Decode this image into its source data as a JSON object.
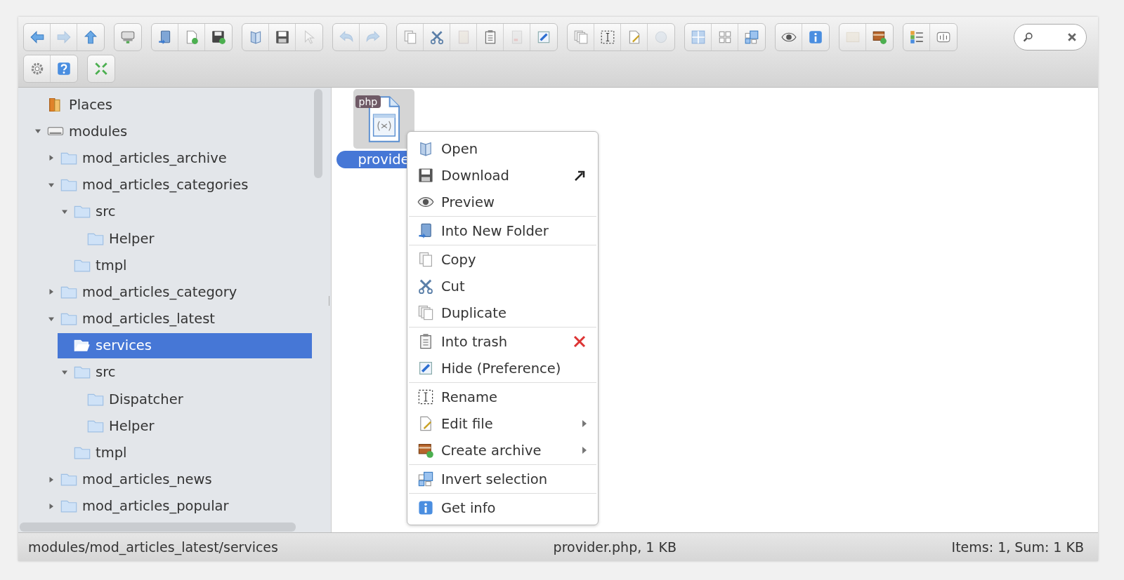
{
  "toolbar": {
    "rows": [
      [
        [
          {
            "kind": "back",
            "disabled": false
          },
          {
            "kind": "forward",
            "disabled": true
          },
          {
            "kind": "up",
            "disabled": false
          }
        ],
        [
          {
            "kind": "drive",
            "disabled": false
          }
        ],
        [
          {
            "kind": "newfolder",
            "disabled": false
          },
          {
            "kind": "newfile",
            "disabled": false
          },
          {
            "kind": "upload",
            "disabled": false
          }
        ],
        [
          {
            "kind": "open",
            "disabled": false
          },
          {
            "kind": "save",
            "disabled": false
          },
          {
            "kind": "select",
            "disabled": true
          }
        ],
        [
          {
            "kind": "undo",
            "disabled": true
          },
          {
            "kind": "redo",
            "disabled": true
          }
        ],
        [
          {
            "kind": "copy",
            "disabled": false
          },
          {
            "kind": "cut",
            "disabled": false
          },
          {
            "kind": "paste",
            "disabled": true
          },
          {
            "kind": "trash",
            "disabled": false
          },
          {
            "kind": "empty",
            "disabled": true
          },
          {
            "kind": "hide",
            "disabled": false
          }
        ],
        [
          {
            "kind": "duplicate",
            "disabled": false
          },
          {
            "kind": "rename",
            "disabled": false
          },
          {
            "kind": "edit",
            "disabled": false
          },
          {
            "kind": "resize",
            "disabled": true
          }
        ],
        [
          {
            "kind": "grid",
            "disabled": false
          },
          {
            "kind": "gridnone",
            "disabled": false
          },
          {
            "kind": "invert",
            "disabled": false
          }
        ],
        [
          {
            "kind": "eye",
            "disabled": false
          },
          {
            "kind": "info",
            "disabled": false
          }
        ],
        [
          {
            "kind": "extract",
            "disabled": true
          },
          {
            "kind": "archive",
            "disabled": false
          }
        ],
        [
          {
            "kind": "list",
            "disabled": false
          },
          {
            "kind": "sort",
            "disabled": false
          }
        ]
      ],
      [
        [
          {
            "kind": "gear",
            "disabled": false
          },
          {
            "kind": "help",
            "disabled": false
          }
        ],
        [
          {
            "kind": "fullscreen",
            "disabled": false
          }
        ]
      ]
    ]
  },
  "tree": [
    {
      "label": "Places",
      "kind": "places",
      "expandable": false,
      "expanded": false,
      "selected": false
    },
    {
      "label": "modules",
      "kind": "drive",
      "expandable": true,
      "expanded": true,
      "selected": false,
      "children": [
        {
          "label": "mod_articles_archive",
          "kind": "folder",
          "expandable": true,
          "expanded": false,
          "selected": false
        },
        {
          "label": "mod_articles_categories",
          "kind": "folder",
          "expandable": true,
          "expanded": true,
          "selected": false,
          "children": [
            {
              "label": "src",
              "kind": "folder",
              "expandable": true,
              "expanded": true,
              "selected": false,
              "children": [
                {
                  "label": "Helper",
                  "kind": "folder",
                  "expandable": false,
                  "expanded": false,
                  "selected": false
                }
              ]
            },
            {
              "label": "tmpl",
              "kind": "folder",
              "expandable": false,
              "expanded": false,
              "selected": false
            }
          ]
        },
        {
          "label": "mod_articles_category",
          "kind": "folder",
          "expandable": true,
          "expanded": false,
          "selected": false
        },
        {
          "label": "mod_articles_latest",
          "kind": "folder",
          "expandable": true,
          "expanded": true,
          "selected": false,
          "children": [
            {
              "label": "services",
              "kind": "folder",
              "expandable": false,
              "expanded": false,
              "selected": true
            },
            {
              "label": "src",
              "kind": "folder",
              "expandable": true,
              "expanded": true,
              "selected": false,
              "children": [
                {
                  "label": "Dispatcher",
                  "kind": "folder",
                  "expandable": false,
                  "expanded": false,
                  "selected": false
                },
                {
                  "label": "Helper",
                  "kind": "folder",
                  "expandable": false,
                  "expanded": false,
                  "selected": false
                }
              ]
            },
            {
              "label": "tmpl",
              "kind": "folder",
              "expandable": false,
              "expanded": false,
              "selected": false
            }
          ]
        },
        {
          "label": "mod_articles_news",
          "kind": "folder",
          "expandable": true,
          "expanded": false,
          "selected": false
        },
        {
          "label": "mod_articles_popular",
          "kind": "folder",
          "expandable": true,
          "expanded": false,
          "selected": false
        }
      ]
    }
  ],
  "files": [
    {
      "name": "provide",
      "badge": "php",
      "selected": true
    }
  ],
  "context_menu": {
    "groups": [
      [
        {
          "label": "Open",
          "kind": "open",
          "submenu": false
        },
        {
          "label": "Download",
          "kind": "download",
          "submenu": false
        },
        {
          "label": "Preview",
          "kind": "preview",
          "submenu": false
        }
      ],
      [
        {
          "label": "Into New Folder",
          "kind": "newfolder",
          "submenu": false
        }
      ],
      [
        {
          "label": "Copy",
          "kind": "copy",
          "submenu": false
        },
        {
          "label": "Cut",
          "kind": "cut",
          "submenu": false
        },
        {
          "label": "Duplicate",
          "kind": "duplicate",
          "submenu": false
        }
      ],
      [
        {
          "label": "Into trash",
          "kind": "trash",
          "submenu": false
        },
        {
          "label": "Hide (Preference)",
          "kind": "hide",
          "submenu": false
        }
      ],
      [
        {
          "label": "Rename",
          "kind": "rename",
          "submenu": false
        },
        {
          "label": "Edit file",
          "kind": "edit",
          "submenu": true
        },
        {
          "label": "Create archive",
          "kind": "archive",
          "submenu": true
        }
      ],
      [
        {
          "label": "Invert selection",
          "kind": "invert",
          "submenu": false
        }
      ],
      [
        {
          "label": "Get info",
          "kind": "info",
          "submenu": false
        }
      ]
    ]
  },
  "status_bar": {
    "path": "modules/mod_articles_latest/services",
    "selection": "provider.php, 1 KB",
    "summary": "Items: 1, Sum: 1 KB"
  }
}
